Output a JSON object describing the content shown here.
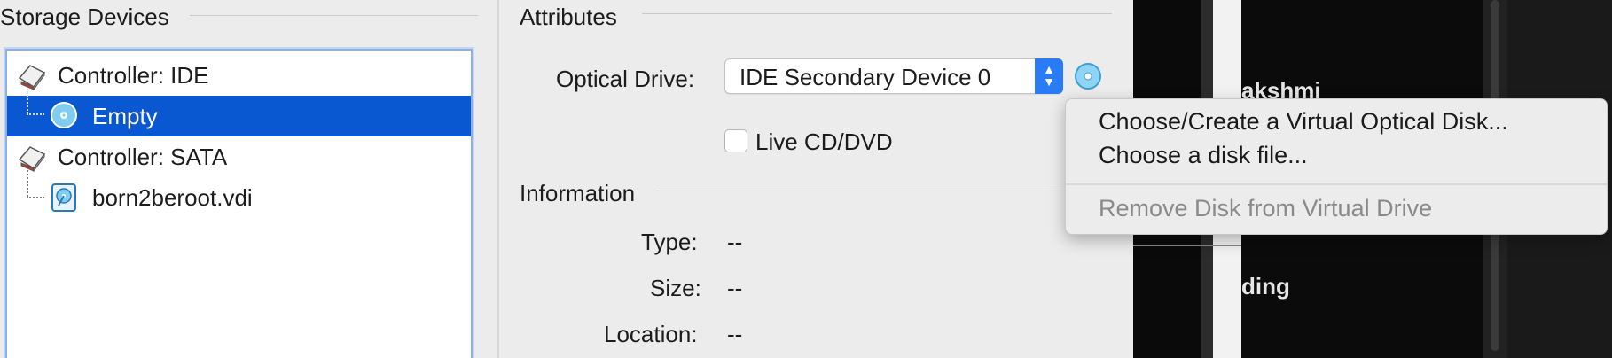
{
  "storage": {
    "title": "Storage Devices",
    "tree": [
      {
        "label": "Controller: IDE"
      },
      {
        "label": "Empty"
      },
      {
        "label": "Controller: SATA"
      },
      {
        "label": "born2beroot.vdi"
      }
    ]
  },
  "attributes": {
    "title": "Attributes",
    "optical_drive_label": "Optical Drive:",
    "optical_drive_value": "IDE Secondary Device 0",
    "live_cd_label": "Live CD/DVD",
    "live_cd_checked": false
  },
  "information": {
    "title": "Information",
    "type_label": "Type:",
    "type_value": "--",
    "size_label": "Size:",
    "size_value": "--",
    "location_label": "Location:",
    "location_value": "--"
  },
  "menu": {
    "items": [
      {
        "label": "Choose/Create a Virtual Optical Disk...",
        "enabled": true
      },
      {
        "label": "Choose a disk file...",
        "enabled": true
      },
      {
        "label": "Remove Disk from Virtual Drive",
        "enabled": false
      }
    ]
  },
  "background": {
    "text1": "akshmi",
    "text2": "ding"
  },
  "colors": {
    "selection": "#0a57d2",
    "accent": "#2a7cf6"
  },
  "icons": {
    "controller": "controller-icon",
    "optical": "optical-disc-icon",
    "hard_disk": "hard-disk-icon",
    "disc_button": "optical-disc-icon"
  }
}
